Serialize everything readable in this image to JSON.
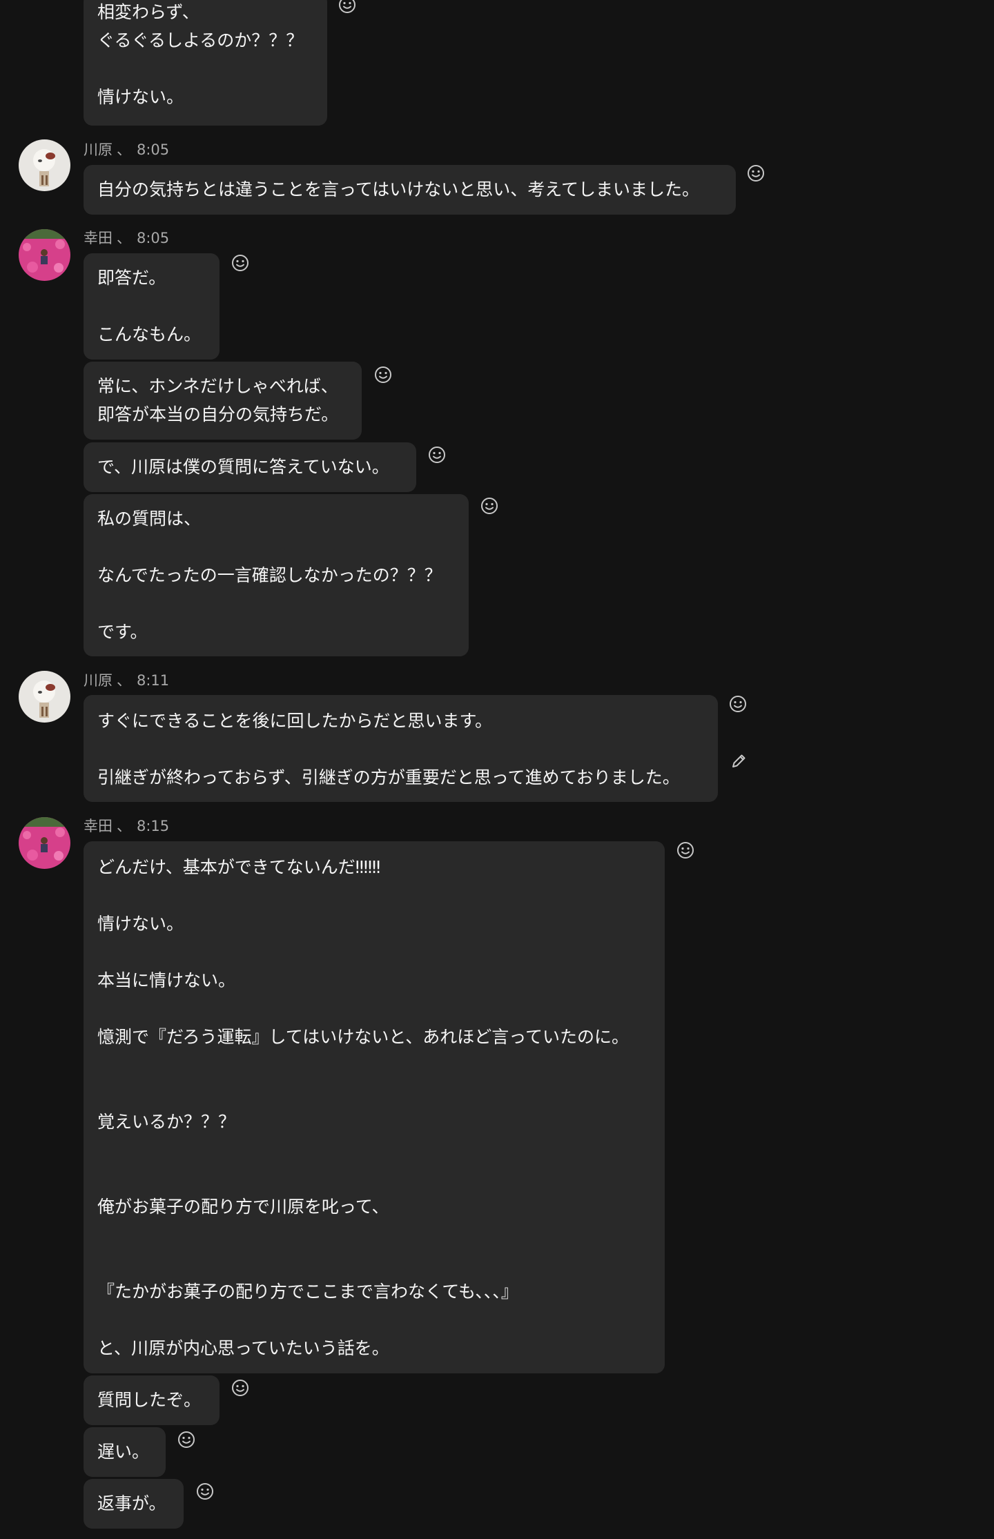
{
  "messages": [
    {
      "lines": [
        "相変わらず、",
        "ぐるぐるしよるのか？？？",
        "",
        "情けない。"
      ]
    },
    {
      "sender": "川原",
      "separator": "、",
      "time": "8:05",
      "lines": [
        "自分の気持ちとは違うことを言ってはいけないと思い、考えてしまいました。"
      ]
    },
    {
      "sender": "幸田",
      "separator": "、",
      "time": "8:05",
      "lines": [
        "即答だ。",
        "",
        "こんなもん。"
      ]
    },
    {
      "lines": [
        "常に、ホンネだけしゃべれば、",
        "即答が本当の自分の気持ちだ。"
      ]
    },
    {
      "lines": [
        "で、川原は僕の質問に答えていない。"
      ]
    },
    {
      "lines": [
        "私の質問は、",
        "",
        "なんでたったの一言確認しなかったの？？？",
        "",
        "です。"
      ]
    },
    {
      "sender": "川原",
      "separator": "、",
      "time": "8:11",
      "lines": [
        "すぐにできることを後に回したからだと思います。",
        "",
        "引継ぎが終わっておらず、引継ぎの方が重要だと思って進めておりました。"
      ]
    },
    {
      "sender": "幸田",
      "separator": "、",
      "time": "8:15",
      "lines": [
        "どんだけ、基本ができてないんだ‼‼‼",
        "",
        "情けない。",
        "",
        "本当に情けない。",
        "",
        "憶測で『だろう運転』してはいけないと、あれほど言っていたのに。",
        "",
        "",
        "覚えいるか？？？",
        "",
        "",
        "俺がお菓子の配り方で川原を叱って、",
        "",
        "",
        "『たかがお菓子の配り方でここまで言わなくても、、、』",
        "",
        "と、川原が内心思っていたいう話を。"
      ]
    },
    {
      "lines": [
        "質問したぞ。"
      ]
    },
    {
      "lines": [
        "遅い。"
      ]
    },
    {
      "lines": [
        "返事が。"
      ]
    }
  ],
  "icons": {
    "reaction": "smiley-icon",
    "edit": "pencil-icon",
    "avatar_kawahara": "kawahara-avatar",
    "avatar_koda": "koda-avatar"
  },
  "colors": {
    "background": "#131313",
    "bubble": "#292929",
    "text": "#f5f5f5",
    "meta_text": "#a9a9a9",
    "icon": "#c8c8c8"
  }
}
